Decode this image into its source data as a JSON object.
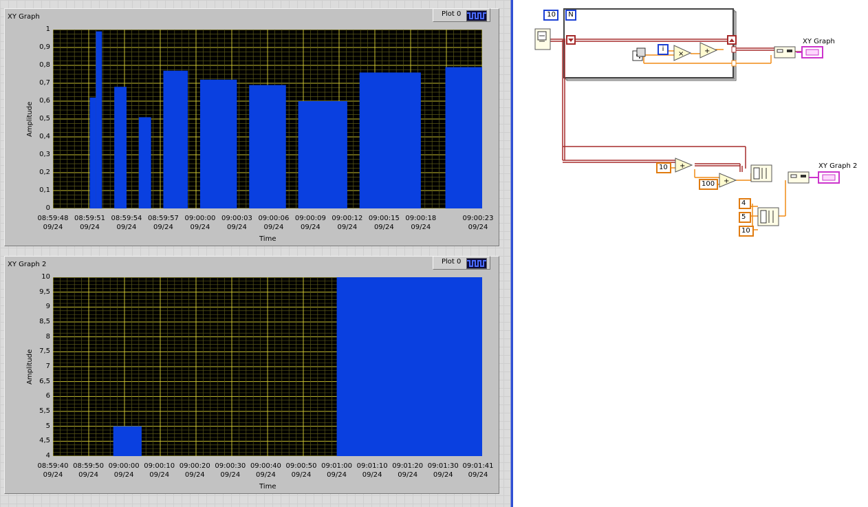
{
  "graph1": {
    "title": "XY Graph",
    "legend_label": "Plot 0",
    "ylabel": "Amplitude",
    "xlabel": "Time",
    "yticks": [
      "1",
      "0,9",
      "0,8",
      "0,7",
      "0,6",
      "0,5",
      "0,4",
      "0,3",
      "0,2",
      "0,1",
      "0"
    ],
    "xticks": [
      {
        "time": "08:59:48",
        "date": "09/24"
      },
      {
        "time": "08:59:51",
        "date": "09/24"
      },
      {
        "time": "08:59:54",
        "date": "09/24"
      },
      {
        "time": "08:59:57",
        "date": "09/24"
      },
      {
        "time": "09:00:00",
        "date": "09/24"
      },
      {
        "time": "09:00:03",
        "date": "09/24"
      },
      {
        "time": "09:00:06",
        "date": "09/24"
      },
      {
        "time": "09:00:09",
        "date": "09/24"
      },
      {
        "time": "09:00:12",
        "date": "09/24"
      },
      {
        "time": "09:00:15",
        "date": "09/24"
      },
      {
        "time": "09:00:18",
        "date": "09/24"
      },
      {
        "time": "09:00:23",
        "date": "09/24"
      }
    ]
  },
  "graph2": {
    "title": "XY Graph 2",
    "legend_label": "Plot 0",
    "ylabel": "Amplitude",
    "xlabel": "Time",
    "yticks": [
      "10",
      "9,5",
      "9",
      "8,5",
      "8",
      "7,5",
      "7",
      "6,5",
      "6",
      "5,5",
      "5",
      "4,5",
      "4"
    ],
    "xticks": [
      {
        "time": "08:59:40",
        "date": "09/24"
      },
      {
        "time": "08:59:50",
        "date": "09/24"
      },
      {
        "time": "09:00:00",
        "date": "09/24"
      },
      {
        "time": "09:00:10",
        "date": "09/24"
      },
      {
        "time": "09:00:20",
        "date": "09/24"
      },
      {
        "time": "09:00:30",
        "date": "09/24"
      },
      {
        "time": "09:00:40",
        "date": "09/24"
      },
      {
        "time": "09:00:50",
        "date": "09/24"
      },
      {
        "time": "09:01:00",
        "date": "09/24"
      },
      {
        "time": "09:01:10",
        "date": "09/24"
      },
      {
        "time": "09:01:20",
        "date": "09/24"
      },
      {
        "time": "09:01:30",
        "date": "09/24"
      },
      {
        "time": "09:01:41",
        "date": "09/24"
      }
    ]
  },
  "chart_data": [
    {
      "type": "bar",
      "title": "XY Graph",
      "xlabel": "Time",
      "ylabel": "Amplitude",
      "ylim": [
        0,
        1
      ],
      "xlim": [
        "08:59:48",
        "09:00:23"
      ],
      "grid": true,
      "bar_color": "#0a40e0",
      "bars": [
        {
          "start": "08:59:51",
          "end": "08:59:51.5",
          "value": 0.62
        },
        {
          "start": "08:59:51.5",
          "end": "08:59:52",
          "value": 0.99
        },
        {
          "start": "08:59:53",
          "end": "08:59:54",
          "value": 0.68
        },
        {
          "start": "08:59:55",
          "end": "08:59:56",
          "value": 0.51
        },
        {
          "start": "08:59:57",
          "end": "08:59:59",
          "value": 0.77
        },
        {
          "start": "09:00:00",
          "end": "09:00:03",
          "value": 0.72
        },
        {
          "start": "09:00:04",
          "end": "09:00:07",
          "value": 0.69
        },
        {
          "start": "09:00:08",
          "end": "09:00:12",
          "value": 0.6
        },
        {
          "start": "09:00:13",
          "end": "09:00:18",
          "value": 0.76
        },
        {
          "start": "09:00:20",
          "end": "09:00:23",
          "value": 0.79
        }
      ]
    },
    {
      "type": "bar",
      "title": "XY Graph 2",
      "xlabel": "Time",
      "ylabel": "Amplitude",
      "ylim": [
        4,
        10
      ],
      "xlim": [
        "08:59:40",
        "09:01:41"
      ],
      "grid": true,
      "bar_color": "#0a40e0",
      "bars": [
        {
          "start": "08:59:50",
          "end": "08:59:54",
          "value": 4
        },
        {
          "start": "08:59:57",
          "end": "09:00:05",
          "value": 5
        },
        {
          "start": "09:01:00",
          "end": "09:01:41",
          "value": 10
        }
      ]
    }
  ],
  "block_diagram": {
    "loop_count": "10",
    "loop_count_terminal": "N",
    "iteration_terminal": "i",
    "xy_graph_label": "XY Graph",
    "xy_graph2_label": "XY Graph 2",
    "const_10": "10",
    "const_100": "100",
    "const_4": "4",
    "const_5": "5",
    "const_10b": "10",
    "wire_colors": {
      "timestamp": "#a52a2a",
      "numeric": "#f08a14",
      "cluster": "#cc33cc"
    }
  }
}
